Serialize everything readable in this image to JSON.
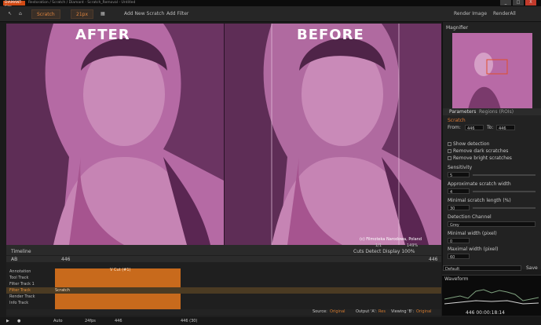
{
  "app": {
    "name": "DIAMANT-Film",
    "window_title": "Restoration / Scratch / Diamant - Scratch_Removal - Untitled"
  },
  "toolbar": {
    "preset": "Scratch",
    "brush_size": "21px",
    "add_new": "Add New Scratch",
    "add_filter": "Add Filter",
    "render_image": "Render Image",
    "render_all": "RenderAll"
  },
  "viewer": {
    "left_label": "AFTER",
    "right_label": "BEFORE",
    "credit": "(c) Filmoteka Narodowa, Poland",
    "zoom": "149%",
    "frame_indicator": "1/1"
  },
  "magnifier": {
    "title": "Magnifier"
  },
  "params": {
    "tab_parameters": "Parameters",
    "tab_regions": "Regions (ROIs)",
    "filter_name": "Scratch",
    "from_label": "From:",
    "from_value": "446",
    "to_label": "To:",
    "to_value": "446",
    "show_detection": "Show detection",
    "remove_dark": "Remove dark scratches",
    "remove_bright": "Remove bright scratches",
    "sensitivity_label": "Sensitivity",
    "sensitivity_value": "5",
    "approx_width_label": "Approximate scratch width",
    "approx_width_value": "4",
    "min_length_label": "Minimal scratch length (%)",
    "min_length_value": "30",
    "channel_label": "Detection Channel",
    "channel_value": "Grey",
    "min_width_label": "Minimal width (pixel)",
    "min_width_value": "0",
    "max_width_label": "Maximal width (pixel)",
    "max_width_value": "60"
  },
  "preset_bar": {
    "value": "Default",
    "save": "Save"
  },
  "waveform": {
    "title": "Waveform",
    "readout": "446  00:00:18:14"
  },
  "timeline": {
    "title": "Timeline",
    "controls": "Cuts  Detect  Display  100%",
    "ab": "AB",
    "frame": "446",
    "frame_right": "446",
    "cut_label": "V Cut (#1)",
    "tracks": [
      "Annotation",
      "Tool Track",
      "Filter Track 1",
      "Filter Track",
      "Render Track",
      "Info Track"
    ],
    "clip_label": "Scratch",
    "source": "Source:",
    "source_val": "Original",
    "output": "Output 'A':",
    "output_val": "Res",
    "viewing": "Viewing 'B':",
    "viewing_val": "Original"
  },
  "status": {
    "auto": "Auto",
    "fps": "24fps",
    "frame": "446",
    "count": "446 (30)"
  }
}
